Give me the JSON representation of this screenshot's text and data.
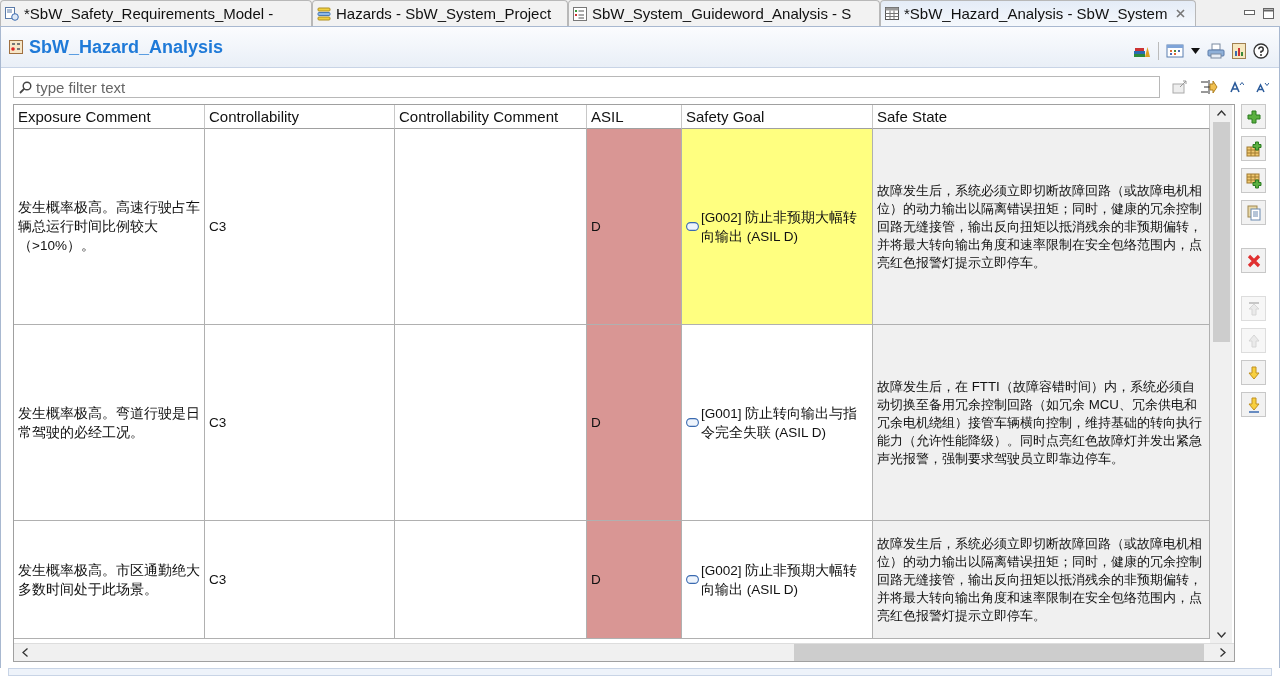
{
  "tabs": [
    {
      "label": "*SbW_Safety_Requirements_Model -",
      "kind": "model",
      "selected": false
    },
    {
      "label": "Hazards - SbW_System_Project",
      "kind": "list",
      "selected": false
    },
    {
      "label": "SbW_System_Guideword_Analysis - S",
      "kind": "form",
      "selected": false
    },
    {
      "label": "*SbW_Hazard_Analysis - SbW_System",
      "kind": "table",
      "selected": true
    }
  ],
  "editor": {
    "title": "SbW_Hazard_Analysis"
  },
  "filter": {
    "placeholder": "type filter text"
  },
  "table": {
    "columns": [
      "Exposure Comment",
      "Controllability",
      "Controllability Comment",
      "ASIL",
      "Safety Goal",
      "Safe State"
    ],
    "rows": [
      {
        "exposure_comment": "发生概率极高。高速行驶占车辆总运行时间比例较大（>10%）。",
        "controllability": "C3",
        "controllability_comment": "",
        "asil": "D",
        "color": "#d99694",
        "safety_goal": "[G002] 防止非预期大幅转向输出 (ASIL D)",
        "safety_goal_highlighted": true,
        "safe_state": "故障发生后，系统必须立即切断故障回路（或故障电机相位）的动力输出以隔离错误扭矩；同时，健康的冗余控制回路无缝接管，输出反向扭矩以抵消残余的非预期偏转，并将最大转向输出角度和速率限制在安全包络范围内，点亮红色报警灯提示立即停车。"
      },
      {
        "exposure_comment": "发生概率极高。弯道行驶是日常驾驶的必经工况。",
        "controllability": "C3",
        "controllability_comment": "",
        "asil": "D",
        "color": "#d99694",
        "safety_goal": "[G001] 防止转向输出与指令完全失联 (ASIL D)",
        "safety_goal_highlighted": false,
        "safe_state": "故障发生后，在 FTTI（故障容错时间）内，系统必须自动切换至备用冗余控制回路（如冗余 MCU、冗余供电和冗余电机绕组）接管车辆横向控制，维持基础的转向执行能力（允许性能降级）。同时点亮红色故障灯并发出紧急声光报警，强制要求驾驶员立即靠边停车。"
      },
      {
        "exposure_comment": "发生概率极高。市区通勤绝大多数时间处于此场景。",
        "controllability": "C3",
        "controllability_comment": "",
        "asil": "D",
        "color": "#d99694",
        "safety_goal": "[G002] 防止非预期大幅转向输出 (ASIL D)",
        "safety_goal_highlighted": false,
        "safe_state": "故障发生后，系统必须立即切断故障回路（或故障电机相位）的动力输出以隔离错误扭矩；同时，健康的冗余控制回路无缝接管，输出反向扭矩以抵消残余的非预期偏转，并将最大转向输出角度和速率限制在安全包络范围内，点亮红色报警灯提示立即停车。"
      }
    ]
  },
  "side_buttons": [
    {
      "kind": "add",
      "disabled": false
    },
    {
      "kind": "add-above",
      "disabled": false
    },
    {
      "kind": "add-below",
      "disabled": false
    },
    {
      "kind": "copy",
      "disabled": false
    },
    {
      "kind": "delete",
      "disabled": false
    },
    {
      "kind": "move-top",
      "disabled": true
    },
    {
      "kind": "move-up",
      "disabled": true
    },
    {
      "kind": "move-down",
      "disabled": false
    },
    {
      "kind": "move-bottom",
      "disabled": false
    }
  ]
}
